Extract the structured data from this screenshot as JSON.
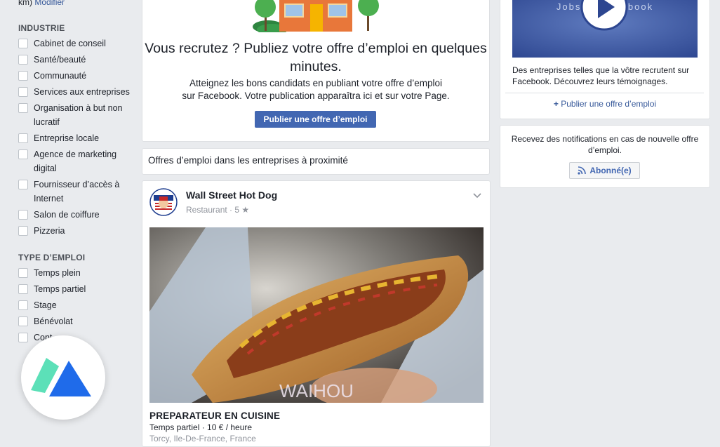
{
  "sidebar": {
    "top_prefix": "km)",
    "modify_label": "Modifier",
    "industry": {
      "title": "INDUSTRIE",
      "options": [
        "Cabinet de conseil",
        "Santé/beauté",
        "Communauté",
        "Services aux entreprises",
        "Organisation à but non lucratif",
        "Entreprise locale",
        "Agence de marketing digital",
        "Fournisseur d’accès à Internet",
        "Salon de coiffure",
        "Pizzeria"
      ]
    },
    "job_type": {
      "title": "TYPE D’EMPLOI",
      "options": [
        "Temps plein",
        "Temps partiel",
        "Stage",
        "Bénévolat",
        "Cont…"
      ]
    }
  },
  "publish": {
    "title": "Vous recrutez ? Publiez votre offre d’emploi en quelques minutes.",
    "subtitle_line1": "Atteignez les bons candidats en publiant votre offre d’emploi",
    "subtitle_line2": "sur Facebook. Votre publication apparaîtra ici et sur votre Page.",
    "button": "Publier une offre d’emploi"
  },
  "nearby": {
    "label": "Offres d’emploi dans les entreprises à proximité"
  },
  "job": {
    "business": "Wall Street Hot Dog",
    "meta": "Restaurant · 5 ★",
    "title": "PREPARATEUR EN CUISINE",
    "details": "Temps partiel · 10 € / heure",
    "location": "Torcy, Ile-De-France, France",
    "photo_watermark": "WAIHOU"
  },
  "right": {
    "video_caption": "Jobs on Facebook",
    "video_desc": "Des entreprises telles que la vôtre recrutent sur Facebook. Découvrez leurs témoignages.",
    "publish_link": "Publier une offre d’emploi",
    "notif_text": "Recevez des notifications en cas de nouvelle offre d’emploi.",
    "subscribed_button": "Abonné(e)"
  },
  "colors": {
    "fb_blue": "#4267b2",
    "link": "#365899",
    "background": "#e9ebee"
  }
}
